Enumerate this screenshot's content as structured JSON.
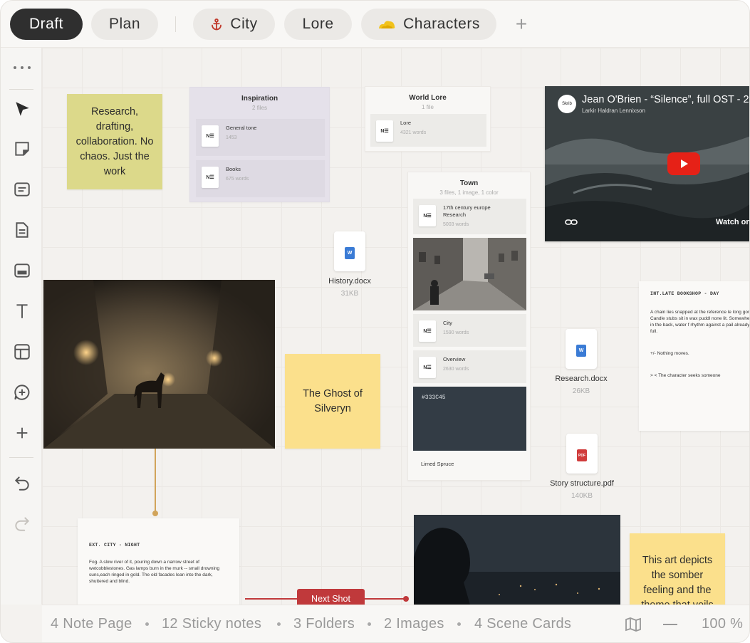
{
  "tabs": [
    {
      "label": "Draft",
      "active": true
    },
    {
      "label": "Plan",
      "active": false
    },
    {
      "label": "City",
      "icon": "anchor-icon",
      "icon_color": "#c0392b"
    },
    {
      "label": "Lore"
    },
    {
      "label": "Characters",
      "icon": "cloud-sun-icon",
      "icon_color": "#e0b020"
    }
  ],
  "add_tab_label": "+",
  "sidebar_tools": [
    "more-icon",
    "pointer-icon",
    "sticky-note-icon",
    "note-icon",
    "document-icon",
    "image-icon",
    "text-icon",
    "layout-icon",
    "add-comment-icon",
    "plus-icon",
    "undo-icon",
    "redo-icon"
  ],
  "stickies": {
    "research": "Research, drafting, collaboration. No chaos. Just the work",
    "ghost": "The Ghost of Silveryn",
    "art": "This art depicts the somber feeling and the theme that veils"
  },
  "colors": {
    "sticky_green": "#dcd98a",
    "sticky_yellow": "#fbe08c",
    "folder_purple": "#e5e1ea",
    "swatch": "#333C45",
    "connector_gold": "#d1a45a",
    "connector_red": "#c0393b"
  },
  "folders": {
    "inspiration": {
      "title": "Inspiration",
      "subtitle": "2 files",
      "items": [
        {
          "name": "General tone",
          "words": "1453"
        },
        {
          "name": "Books",
          "words": "675 words"
        }
      ]
    },
    "world_lore": {
      "title": "World Lore",
      "subtitle": "1 file",
      "items": [
        {
          "name": "Lore",
          "words": "4321 words"
        }
      ]
    },
    "town": {
      "title": "Town",
      "subtitle": "3 files, 1 image, 1 color",
      "items": [
        {
          "name": "17th century  europe Research",
          "words": "5003 words"
        },
        {
          "name": "City",
          "words": "1590 words"
        },
        {
          "name": "Overview",
          "words": "2630 words"
        }
      ],
      "swatch_label": "#333C45",
      "swatch_name": "Limed Spruce"
    }
  },
  "files": {
    "history": {
      "name": "History.docx",
      "size": "31KB",
      "badge": "W"
    },
    "research": {
      "name": "Research.docx",
      "size": "26KB",
      "badge": "W"
    },
    "structure": {
      "name": "Story structure.pdf",
      "size": "140KB",
      "badge": "PDF"
    }
  },
  "video": {
    "title": "Jean O'Brien - “Silence”, full OST - 2",
    "channel": "Larkir Haldran Lennixson",
    "avatar": "Skrib",
    "watch": "Watch on"
  },
  "scenes": {
    "bookshop": {
      "heading": "INT.LATE BOOKSHOP - DAY",
      "body": "A chain lies snapped at the reference le long gone. Candle stubs sit in wax puddl none lit. Somewhere in the back, water f rhythm against a pail already full.",
      "line1": "+/-  Nothing moves.",
      "line2": "> <  The character seeks someone"
    },
    "city_night": {
      "heading": "EXT. CITY - NIGHT",
      "body": "Fog. A slow river of it, pouring down a narrow street of wetcobblestones. Gas lamps burn in the murk -- small drowning suns,each ringed in gold. The old facades lean into the dark, shuttered and blind."
    }
  },
  "connector_label": "Next Shot",
  "status": {
    "notes": "4 Note Page",
    "stickies": "12 Sticky notes",
    "folders": "3 Folders",
    "images": "2 Images",
    "scenes": "4 Scene Cards",
    "zoom": "100 %"
  }
}
